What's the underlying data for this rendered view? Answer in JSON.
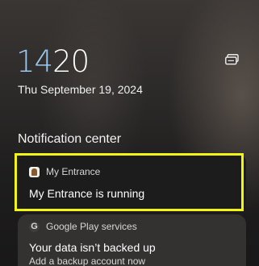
{
  "lockscreen": {
    "clock_hours": "14",
    "clock_minutes": "20",
    "date": "Thu September 19, 2024",
    "status_icon": "notification-stack-icon"
  },
  "notification_center": {
    "title": "Notification center",
    "notifications": [
      {
        "app": "My Entrance",
        "icon": "my-entrance-app-icon",
        "title": "My Entrance is running",
        "highlighted": true,
        "highlight_color": "#f3f514"
      },
      {
        "app": "Google Play services",
        "icon": "google-g-icon",
        "title": "Your data isn’t backed up",
        "text": "Add a backup account now"
      }
    ]
  },
  "colors": {
    "hours_accent": "#9cc9ee",
    "text": "#ffffff"
  }
}
